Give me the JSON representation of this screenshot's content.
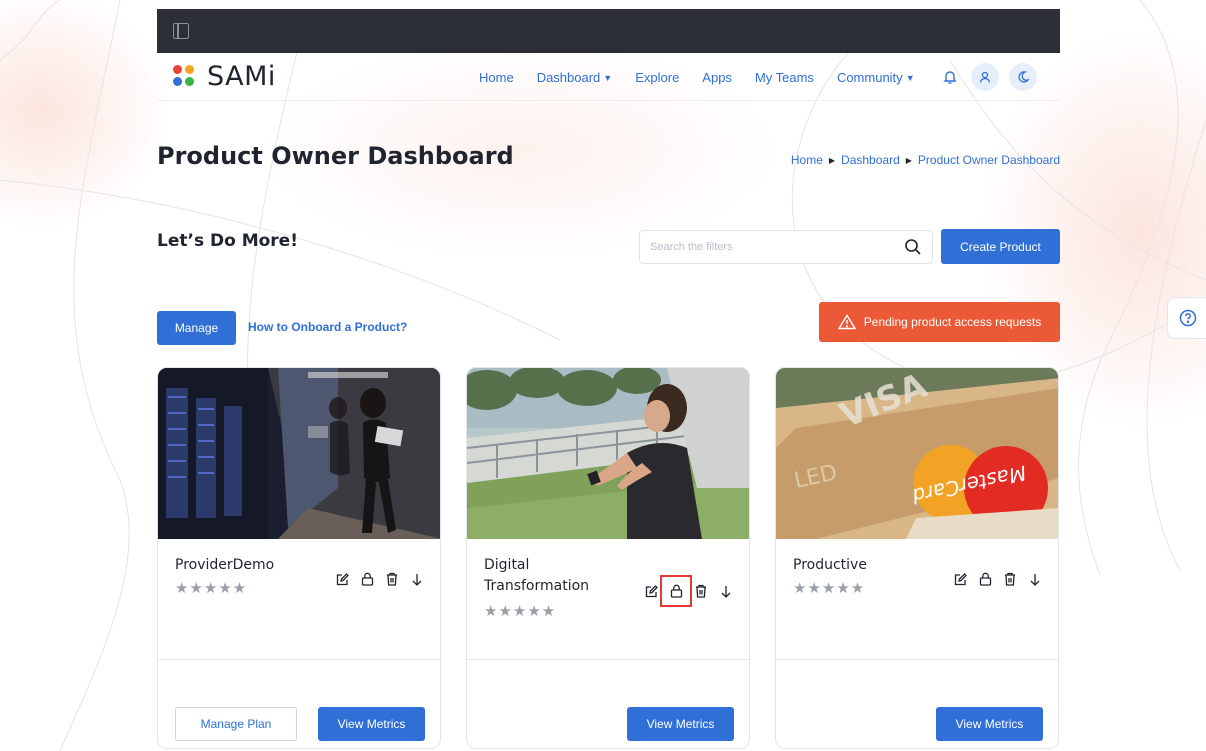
{
  "nav": {
    "brand": "SAMi",
    "links": [
      {
        "label": "Home",
        "dropdown": false
      },
      {
        "label": "Dashboard",
        "dropdown": true
      },
      {
        "label": "Explore",
        "dropdown": false
      },
      {
        "label": "Apps",
        "dropdown": false
      },
      {
        "label": "My Teams",
        "dropdown": false
      },
      {
        "label": "Community",
        "dropdown": true
      }
    ],
    "icons": [
      "bell-icon",
      "user-icon",
      "moon-icon"
    ]
  },
  "page": {
    "title": "Product Owner Dashboard",
    "breadcrumb": [
      "Home",
      "Dashboard",
      "Product Owner Dashboard"
    ],
    "subtitle": "Let’s Do More!"
  },
  "search": {
    "placeholder": "Search the filters",
    "value": ""
  },
  "actions": {
    "create": "Create Product",
    "manage": "Manage",
    "onboard": "How to Onboard a Product?",
    "pending": "Pending product access requests"
  },
  "cards": [
    {
      "title": "ProviderDemo",
      "stars": "★★★★★",
      "rating": 0,
      "manage_plan": "Manage Plan",
      "metrics": "View Metrics"
    },
    {
      "title": "Digital Transformation",
      "stars": "★★★★★",
      "rating": 0,
      "metrics": "View Metrics",
      "highlighted_action": "lock-icon"
    },
    {
      "title": "Productive",
      "stars": "★★★★★",
      "rating": 0,
      "metrics": "View Metrics"
    }
  ],
  "colors": {
    "accent": "#2f6fd6",
    "alert": "#ec5937",
    "topbar": "#2c2f38",
    "highlight": "#e53935"
  }
}
